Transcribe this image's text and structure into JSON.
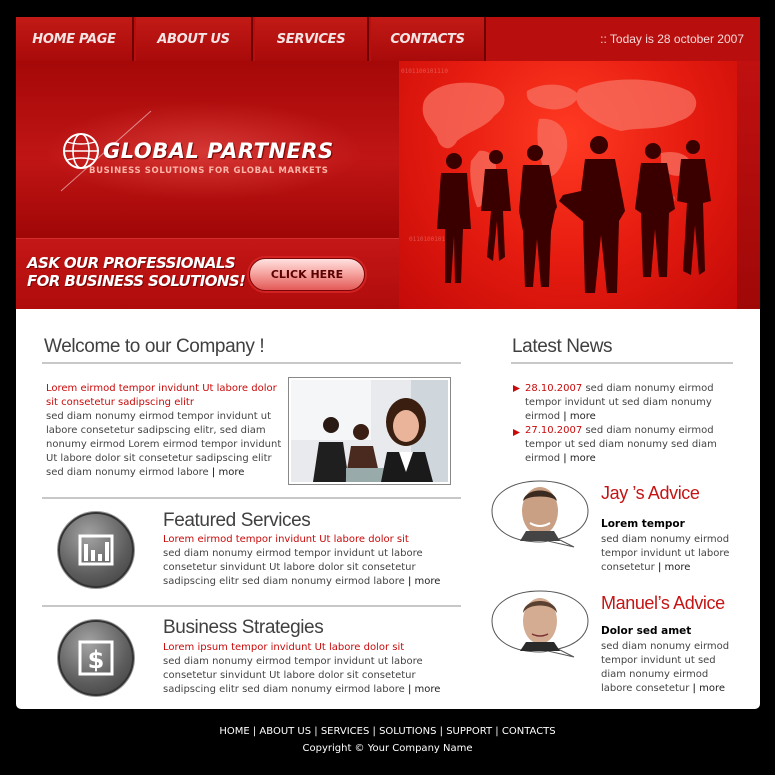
{
  "nav": {
    "items": [
      "HOME PAGE",
      "ABOUT US",
      "SERVICES",
      "CONTACTS"
    ],
    "date": ":: Today is 28 october 2007"
  },
  "header": {
    "logo_title": "GLOBAL PARTNERS",
    "logo_subtitle": "BUSINESS SOLUTIONS FOR GLOBAL MARKETS",
    "ask_line1": "ASK OUR PROFESSIONALS",
    "ask_line2": "FOR BUSINESS SOLUTIONS!",
    "click_button": "CLICK HERE"
  },
  "welcome": {
    "title": "Welcome to our Company !",
    "lead": "Lorem eirmod tempor invidunt Ut labore dolor sit consetetur sadipscing elitr",
    "body": "sed diam nonumy eirmod tempor invidunt ut labore consetetur sadipscing elitr, sed diam nonumy eirmod Lorem eirmod tempor invidunt Ut labore dolor sit  consetetur sadipscing elitr  sed diam nonumy eirmod labore",
    "more": "more"
  },
  "featured": {
    "title": "Featured Services",
    "lead": "Lorem eirmod tempor invidunt Ut labore dolor sit",
    "body": "sed diam nonumy eirmod tempor invidunt ut labore consetetur sinvidunt Ut labore dolor sit  consetetur sadipscing elitr  sed diam nonumy eirmod labore",
    "more": "more"
  },
  "strategies": {
    "title": "Business Strategies",
    "lead": "Lorem ipsum tempor invidunt Ut labore dolor sit",
    "body": "sed diam nonumy eirmod tempor invidunt ut labore consetetur sinvidunt Ut labore dolor sit  consetetur sadipscing elitr  sed diam nonumy eirmod labore",
    "more": "more"
  },
  "news": {
    "title": "Latest News",
    "items": [
      {
        "date": "28.10.2007",
        "text": "sed diam nonumy eirmod tempor invidunt ut sed diam nonumy eirmod",
        "more": "more"
      },
      {
        "date": "27.10.2007",
        "text": "sed diam nonumy eirmod tempor ut sed diam nonumy sed diam eirmod",
        "more": "more"
      }
    ]
  },
  "advice": [
    {
      "title": "Jay ’s Advice",
      "heading": "Lorem tempor",
      "text": "sed diam nonumy eirmod tempor invidunt ut labore consetetur",
      "more": "more"
    },
    {
      "title": "Manuel’s Advice",
      "heading": "Dolor sed amet",
      "text": "sed diam nonumy eirmod tempor invidunt ut sed diam nonumy eirmod  labore consetetur",
      "more": "more"
    }
  ],
  "footer": {
    "links": [
      "HOME",
      "ABOUT US",
      "SERVICES",
      "SOLUTIONS",
      "SUPPORT",
      "CONTACTS"
    ],
    "copyright": "Copyright © Your Company Name"
  },
  "colors": {
    "brand_red": "#b80e0e",
    "text_red": "#c80a0a",
    "background": "#000000"
  }
}
